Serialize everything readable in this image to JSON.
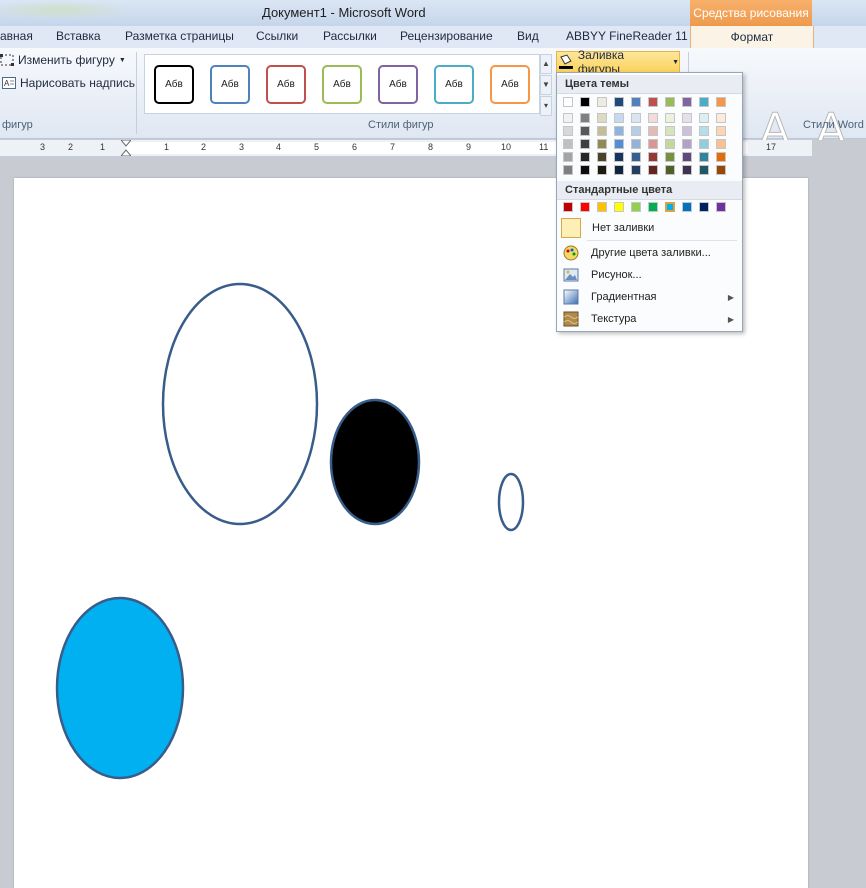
{
  "window": {
    "title": "Документ1  -  Microsoft Word",
    "contextual_header": "Средства рисования"
  },
  "tabs": [
    "авная",
    "Вставка",
    "Разметка страницы",
    "Ссылки",
    "Рассылки",
    "Рецензирование",
    "Вид",
    "ABBYY FineReader 11"
  ],
  "active_tab": "Формат",
  "ribbon": {
    "insert_shapes": {
      "edit_shape": "Изменить фигуру",
      "draw_textbox": "Нарисовать надпись",
      "label": "фигур"
    },
    "shape_styles": {
      "label": "Стили фигур",
      "sample_text": "Абв",
      "preset_colors": [
        "#000000",
        "#4f81bd",
        "#c0504d",
        "#9bbb59",
        "#8064a2",
        "#4bacc6",
        "#f79646"
      ]
    },
    "shape_fill_button": "Заливка фигуры",
    "wordart_label": "Стили Word"
  },
  "ruler": {
    "numbers": [
      "3",
      "2",
      "1",
      "1",
      "2",
      "3",
      "4",
      "5",
      "6",
      "7",
      "8",
      "9",
      "10",
      "11",
      "17"
    ]
  },
  "fill_menu": {
    "theme_colors_header": "Цвета темы",
    "theme_top_row": [
      "#ffffff",
      "#000000",
      "#eeece1",
      "#1f497d",
      "#4f81bd",
      "#c0504d",
      "#9bbb59",
      "#8064a2",
      "#4bacc6",
      "#f79646"
    ],
    "theme_shades": [
      [
        "#f2f2f2",
        "#7f7f7f",
        "#ddd9c3",
        "#c6d9f0",
        "#dbe5f1",
        "#f2dcdb",
        "#ebf1dd",
        "#e5e0ec",
        "#dbeef3",
        "#fdeada"
      ],
      [
        "#d8d8d8",
        "#595959",
        "#c4bd97",
        "#8db3e2",
        "#b8cce4",
        "#e5b9b7",
        "#d7e3bc",
        "#ccc1d9",
        "#b7dde8",
        "#fbd5b5"
      ],
      [
        "#bfbfbf",
        "#3f3f3f",
        "#938953",
        "#548dd4",
        "#95b3d7",
        "#d99694",
        "#c3d69b",
        "#b2a2c7",
        "#92cddc",
        "#fac08f"
      ],
      [
        "#a5a5a5",
        "#262626",
        "#494429",
        "#17365d",
        "#366092",
        "#953734",
        "#76923c",
        "#5f497a",
        "#31859b",
        "#e36c09"
      ],
      [
        "#7f7f7f",
        "#0c0c0c",
        "#1d1b10",
        "#0f243e",
        "#244061",
        "#632423",
        "#4f6128",
        "#3f3151",
        "#205867",
        "#974806"
      ]
    ],
    "standard_colors_header": "Стандартные цвета",
    "standard_colors": [
      "#c00000",
      "#ff0000",
      "#ffc000",
      "#ffff00",
      "#92d050",
      "#00b050",
      "#00b0f0",
      "#0070c0",
      "#002060",
      "#7030a0"
    ],
    "items": {
      "no_fill": "Нет заливки",
      "more_colors": "Другие цвета заливки...",
      "picture": "Рисунок...",
      "gradient": "Градиентная",
      "texture": "Текстура"
    }
  },
  "document": {
    "shapes": [
      {
        "name": "ellipse-outline-large",
        "fill": "none",
        "stroke": "#385d8a"
      },
      {
        "name": "ellipse-black",
        "fill": "#000000",
        "stroke": "#385d8a"
      },
      {
        "name": "ellipse-small",
        "fill": "none",
        "stroke": "#385d8a"
      },
      {
        "name": "ellipse-blue",
        "fill": "#00b0f0",
        "stroke": "#385d8a"
      }
    ]
  }
}
